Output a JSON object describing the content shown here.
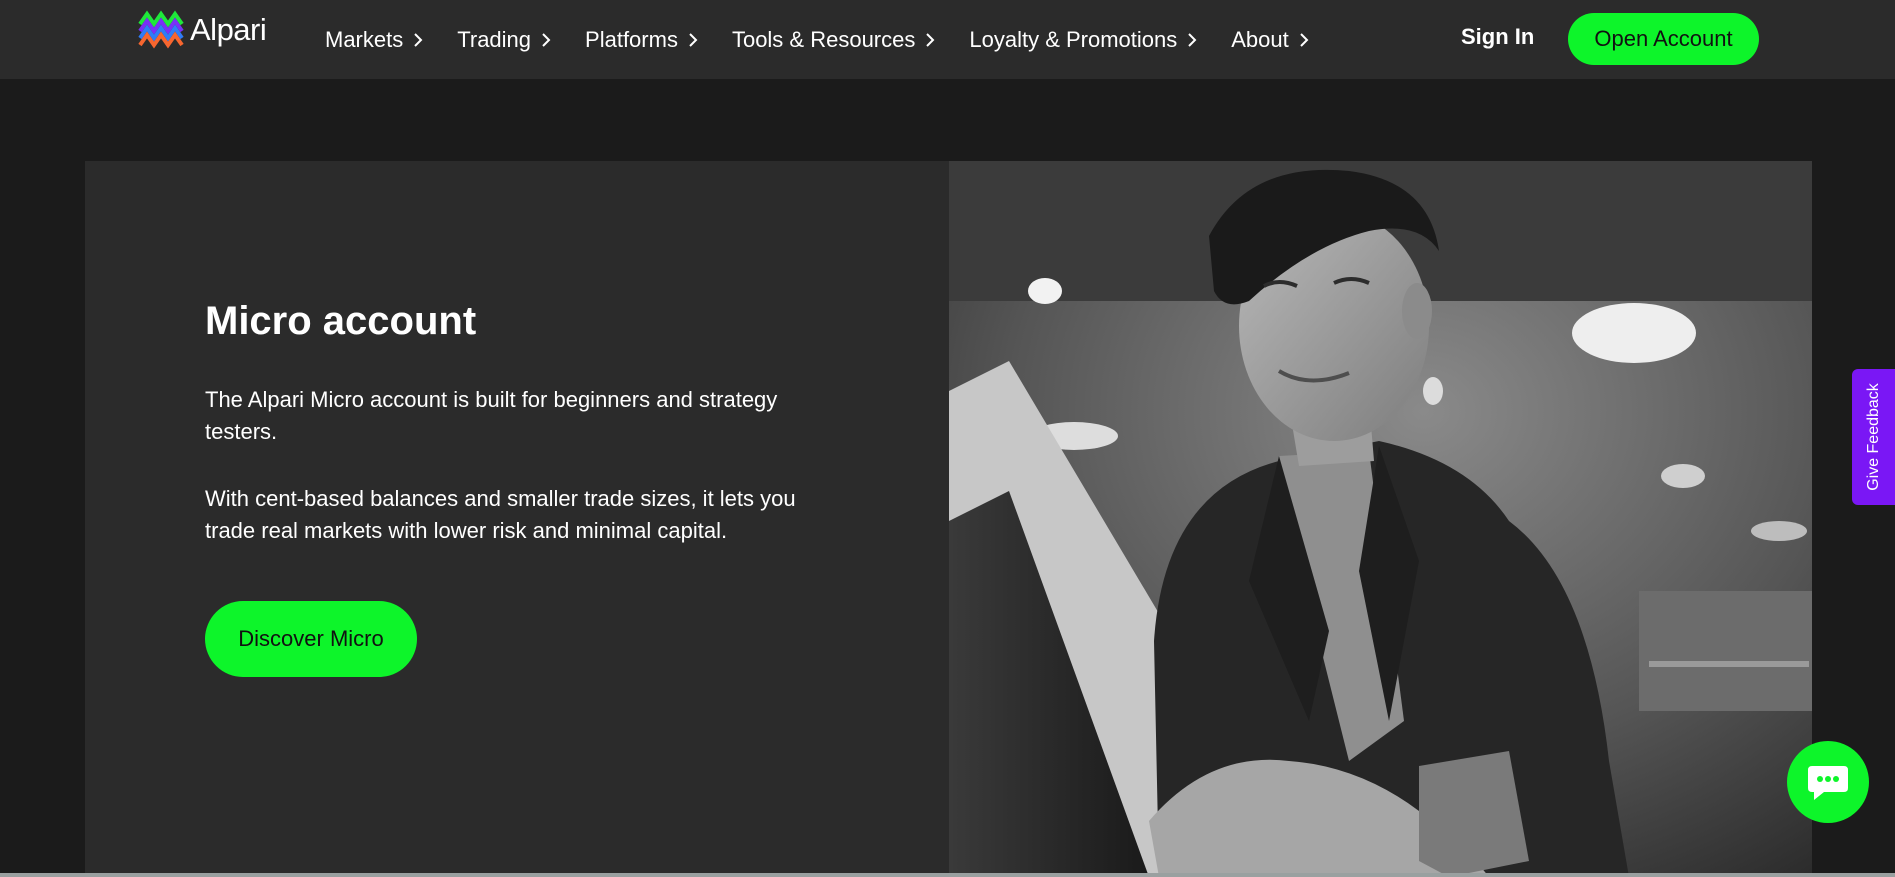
{
  "brand": {
    "name": "Alpari"
  },
  "nav": {
    "items": [
      {
        "label": "Markets"
      },
      {
        "label": "Trading"
      },
      {
        "label": "Platforms"
      },
      {
        "label": "Tools & Resources"
      },
      {
        "label": "Loyalty & Promotions"
      },
      {
        "label": "About"
      }
    ],
    "sign_in": "Sign In",
    "open_account": "Open Account"
  },
  "card": {
    "title": "Micro account",
    "paragraph1": "The Alpari Micro account is built for beginners and strategy testers.",
    "paragraph2": "With cent-based balances and smaller trade sizes, it lets you trade real markets with lower risk and minimal capital.",
    "cta": "Discover Micro"
  },
  "feedback": {
    "label": "Give Feedback"
  },
  "colors": {
    "accent": "#0df52a",
    "feedback": "#7a17f5",
    "nav_bg": "#2b2b2b",
    "page_bg": "#1b1b1b"
  },
  "icons": {
    "logo": "alpari-logo-icon",
    "chevron": "chevron-right-icon",
    "chat": "chat-bubble-icon"
  }
}
